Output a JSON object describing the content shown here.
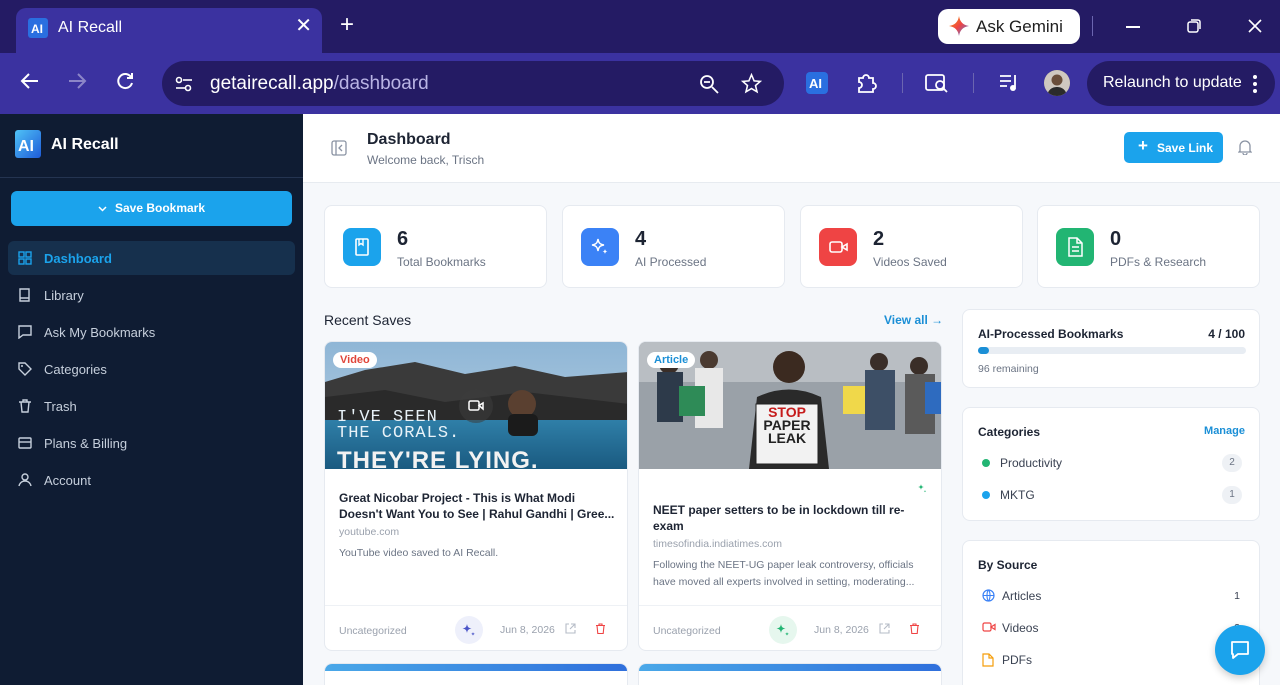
{
  "browser": {
    "tab_title": "AI Recall",
    "tab_close": "✕",
    "new_tab": "+",
    "gemini_label": "Ask Gemini",
    "url_host": "getairecall.app",
    "url_path": "/dashboard",
    "relaunch_label": "Relaunch to update"
  },
  "sidebar": {
    "brand": "AI Recall",
    "save_bookmark": "Save Bookmark",
    "items": [
      {
        "label": "Dashboard",
        "icon": "grid-icon",
        "active": true
      },
      {
        "label": "Library",
        "icon": "book-icon"
      },
      {
        "label": "Ask My Bookmarks",
        "icon": "chat-icon"
      },
      {
        "label": "Categories",
        "icon": "tag-icon"
      },
      {
        "label": "Trash",
        "icon": "trash-icon"
      },
      {
        "label": "Plans & Billing",
        "icon": "card-icon"
      },
      {
        "label": "Account",
        "icon": "user-icon"
      }
    ]
  },
  "header": {
    "title": "Dashboard",
    "welcome": "Welcome back, Trisch",
    "save_link": "Save Link"
  },
  "stats": [
    {
      "value": "6",
      "label": "Total Bookmarks",
      "color": "#1ba3ec",
      "icon": "bookmark-icon"
    },
    {
      "value": "4",
      "label": "AI Processed",
      "color": "#3b82f6",
      "icon": "sparkle-icon"
    },
    {
      "value": "2",
      "label": "Videos Saved",
      "color": "#ef4444",
      "icon": "video-icon"
    },
    {
      "value": "0",
      "label": "PDFs & Research",
      "color": "#22b573",
      "icon": "document-icon"
    }
  ],
  "recent": {
    "title": "Recent Saves",
    "view_all": "View all →",
    "cards": [
      {
        "type": "Video",
        "type_color": "#e0453a",
        "title": "Great Nicobar Project - This is What Modi Doesn't Want You to See | Rahul Gandhi | Gree...",
        "domain": "youtube.com",
        "description": "YouTube video saved to AI Recall.",
        "category": "Uncategorized",
        "date": "Jun 8, 2026",
        "thumb_text": [
          "I'VE SEEN",
          "THE CORALS.",
          "THEY'RE LYING."
        ]
      },
      {
        "type": "Article",
        "type_color": "#1b8fd6",
        "title": "NEET paper setters to be in lockdown till re-exam",
        "domain": "timesofindia.indiatimes.com",
        "description": "Following the NEET-UG paper leak controversy, officials have moved all experts involved in setting, moderating...",
        "category": "Uncategorized",
        "date": "Jun 8, 2026",
        "thumb_text": [
          "STOP",
          "PAPER",
          "LEAK"
        ]
      }
    ]
  },
  "ai_panel": {
    "title": "AI-Processed Bookmarks",
    "count": "4 / 100",
    "progress": 0.04,
    "remaining": "96 remaining"
  },
  "categories_panel": {
    "title": "Categories",
    "manage": "Manage",
    "items": [
      {
        "name": "Productivity",
        "count": "2",
        "color": "#22b573"
      },
      {
        "name": "MKTG",
        "count": "1",
        "color": "#1ba3ec"
      }
    ]
  },
  "source_panel": {
    "title": "By Source",
    "items": [
      {
        "name": "Articles",
        "count": "1",
        "icon": "globe-icon"
      },
      {
        "name": "Videos",
        "count": "2",
        "icon": "video-icon"
      },
      {
        "name": "PDFs",
        "count": "",
        "icon": "document-icon"
      }
    ]
  }
}
